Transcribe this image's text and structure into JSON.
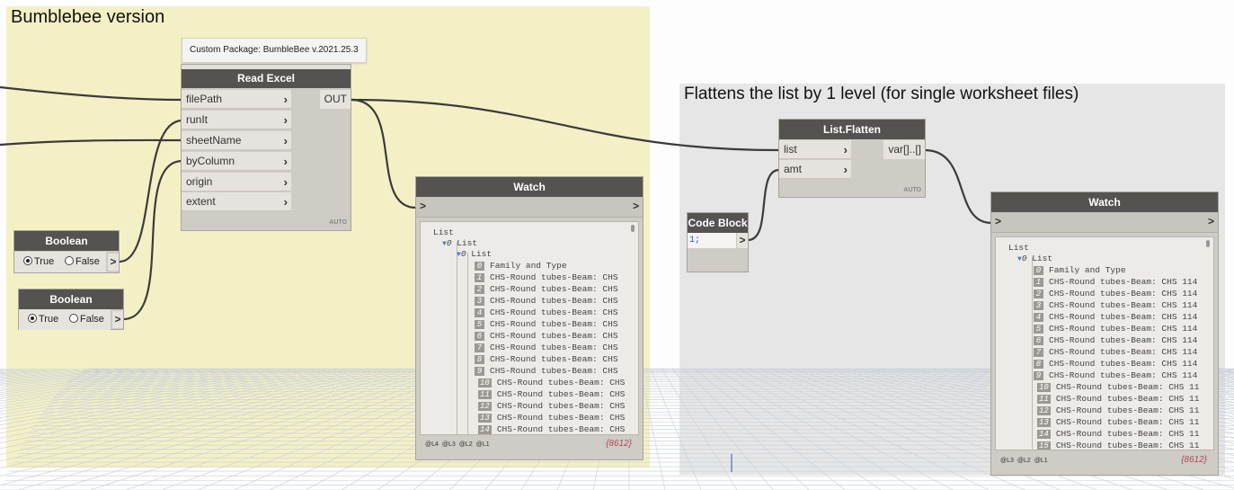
{
  "colors": {
    "group_bumblebee": "#f4f0c6",
    "group_flatten": "#e6e6e6",
    "node_header": "#555350",
    "node_body": "#cfcbc5",
    "wire": "#3b3b3b",
    "count": "#b0475a"
  },
  "groups": {
    "bumblebee": {
      "title": "Bumblebee version"
    },
    "flatten": {
      "title": "Flattens the list by 1 level (for single worksheet files)"
    }
  },
  "read_excel": {
    "tooltip": "Custom Package: BumbleBee v.2021.25.3",
    "title": "Read Excel",
    "inputs": [
      "filePath",
      "runIt",
      "sheetName",
      "byColumn",
      "origin",
      "extent"
    ],
    "output": "OUT",
    "lacing": "AUTO"
  },
  "boolean1": {
    "title": "Boolean",
    "true_label": "True",
    "false_label": "False",
    "selected": "True",
    "out": ">"
  },
  "boolean2": {
    "title": "Boolean",
    "true_label": "True",
    "false_label": "False",
    "selected": "True",
    "out": ">"
  },
  "list_flatten": {
    "title": "List.Flatten",
    "inputs": [
      "list",
      "amt"
    ],
    "output": "var[]..[]",
    "lacing": "AUTO"
  },
  "code_block": {
    "title": "Code Block",
    "code": "1;",
    "out": ">"
  },
  "watch1": {
    "title": "Watch",
    "in_port": ">",
    "out_port": ">",
    "root": "List",
    "level1": "List",
    "level2": "List",
    "index0": "0",
    "index0b": "0",
    "header_item": "Family and Type",
    "items": [
      {
        "i": "0",
        "t": "Family and Type"
      },
      {
        "i": "1",
        "t": "CHS-Round tubes-Beam: CHS"
      },
      {
        "i": "2",
        "t": "CHS-Round tubes-Beam: CHS"
      },
      {
        "i": "3",
        "t": "CHS-Round tubes-Beam: CHS"
      },
      {
        "i": "4",
        "t": "CHS-Round tubes-Beam: CHS"
      },
      {
        "i": "5",
        "t": "CHS-Round tubes-Beam: CHS"
      },
      {
        "i": "6",
        "t": "CHS-Round tubes-Beam: CHS"
      },
      {
        "i": "7",
        "t": "CHS-Round tubes-Beam: CHS"
      },
      {
        "i": "8",
        "t": "CHS-Round tubes-Beam: CHS"
      },
      {
        "i": "9",
        "t": "CHS-Round tubes-Beam: CHS"
      },
      {
        "i": "10",
        "t": "CHS-Round tubes-Beam: CHS"
      },
      {
        "i": "11",
        "t": "CHS-Round tubes-Beam: CHS"
      },
      {
        "i": "12",
        "t": "CHS-Round tubes-Beam: CHS"
      },
      {
        "i": "13",
        "t": "CHS-Round tubes-Beam: CHS"
      },
      {
        "i": "14",
        "t": "CHS-Round tubes-Beam: CHS"
      }
    ],
    "levels": [
      "@L4",
      "@L3",
      "@L2",
      "@L1"
    ],
    "count": "{8612}"
  },
  "watch2": {
    "title": "Watch",
    "in_port": ">",
    "out_port": ">",
    "root": "List",
    "level1": "List",
    "index0": "0",
    "items": [
      {
        "i": "0",
        "t": "Family and Type"
      },
      {
        "i": "1",
        "t": "CHS-Round tubes-Beam: CHS 114"
      },
      {
        "i": "2",
        "t": "CHS-Round tubes-Beam: CHS 114"
      },
      {
        "i": "3",
        "t": "CHS-Round tubes-Beam: CHS 114"
      },
      {
        "i": "4",
        "t": "CHS-Round tubes-Beam: CHS 114"
      },
      {
        "i": "5",
        "t": "CHS-Round tubes-Beam: CHS 114"
      },
      {
        "i": "6",
        "t": "CHS-Round tubes-Beam: CHS 114"
      },
      {
        "i": "7",
        "t": "CHS-Round tubes-Beam: CHS 114"
      },
      {
        "i": "8",
        "t": "CHS-Round tubes-Beam: CHS 114"
      },
      {
        "i": "9",
        "t": "CHS-Round tubes-Beam: CHS 114"
      },
      {
        "i": "10",
        "t": "CHS-Round tubes-Beam: CHS 11"
      },
      {
        "i": "11",
        "t": "CHS-Round tubes-Beam: CHS 11"
      },
      {
        "i": "12",
        "t": "CHS-Round tubes-Beam: CHS 11"
      },
      {
        "i": "13",
        "t": "CHS-Round tubes-Beam: CHS 11"
      },
      {
        "i": "14",
        "t": "CHS-Round tubes-Beam: CHS 11"
      },
      {
        "i": "15",
        "t": "CHS-Round tubes-Beam: CHS 11"
      }
    ],
    "levels": [
      "@L3",
      "@L2",
      "@L1"
    ],
    "count": "{8612}"
  }
}
